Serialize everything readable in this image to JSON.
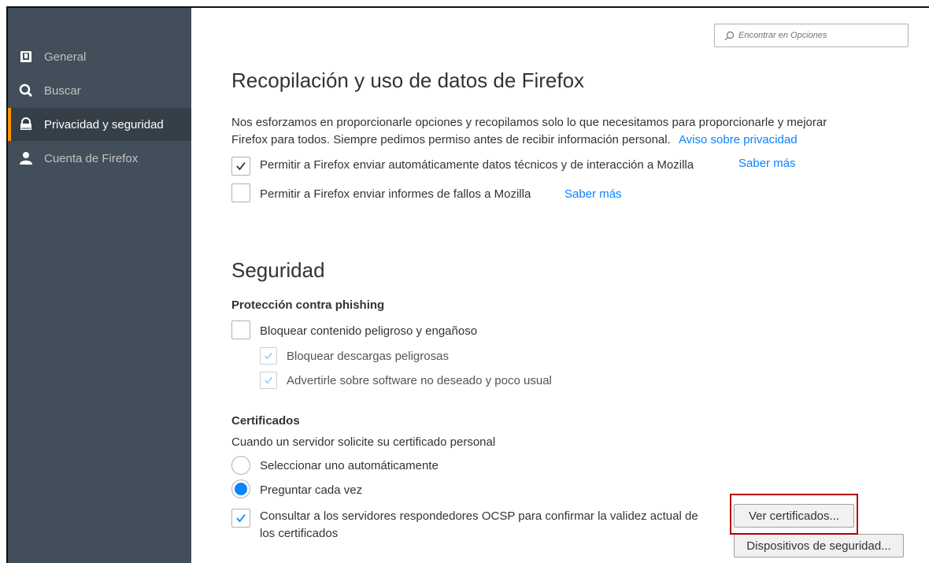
{
  "sidebar": {
    "items": [
      {
        "label": "General",
        "icon": "general-icon",
        "active": false
      },
      {
        "label": "Buscar",
        "icon": "search-icon",
        "active": false
      },
      {
        "label": "Privacidad y seguridad",
        "icon": "lock-icon",
        "active": true
      },
      {
        "label": "Cuenta de Firefox",
        "icon": "account-icon",
        "active": false
      }
    ]
  },
  "search": {
    "placeholder": "Encontrar en Opciones",
    "value": ""
  },
  "data_collection": {
    "title": "Recopilación y uso de datos de Firefox",
    "description_line1": "Nos esforzamos en proporcionarle opciones y recopilamos solo lo que necesitamos para proporcionarle y mejorar",
    "description_line2": "Firefox para todos. Siempre pedimos permiso antes de recibir información personal.",
    "privacy_link": "Aviso sobre privacidad",
    "technical_data": {
      "label": "Permitir a Firefox enviar automáticamente datos técnicos y de interacción a Mozilla",
      "checked": true,
      "learn_more": "Saber más"
    },
    "crash_reports": {
      "label": "Permitir a Firefox enviar informes de fallos a Mozilla",
      "checked": false,
      "learn_more": "Saber más"
    }
  },
  "security": {
    "title": "Seguridad",
    "phishing": {
      "heading": "Protección contra phishing",
      "block_dangerous": {
        "label": "Bloquear contenido peligroso y engañoso",
        "checked": false
      },
      "block_downloads": {
        "label": "Bloquear descargas peligrosas",
        "checked": true,
        "disabled": true
      },
      "warn_unwanted": {
        "label": "Advertirle sobre software no deseado y poco usual",
        "checked": true,
        "disabled": true
      }
    },
    "certificates": {
      "heading": "Certificados",
      "prompt": "Cuando un servidor solicite su certificado personal",
      "auto_select": {
        "label": "Seleccionar uno automáticamente",
        "checked": false
      },
      "ask_every_time": {
        "label": "Preguntar cada vez",
        "checked": true
      },
      "ocsp": {
        "label_line1": "Consultar a los servidores respondedores OCSP para confirmar la validez actual de",
        "label_line2": "los certificados",
        "checked": true
      },
      "view_certificates_button": "Ver certificados...",
      "security_devices_button": "Dispositivos de seguridad..."
    }
  },
  "colors": {
    "sidebar": "#424f5a",
    "sidebar_active": "#343f48",
    "accent": "#0a84ff",
    "highlight": "#b30000"
  }
}
